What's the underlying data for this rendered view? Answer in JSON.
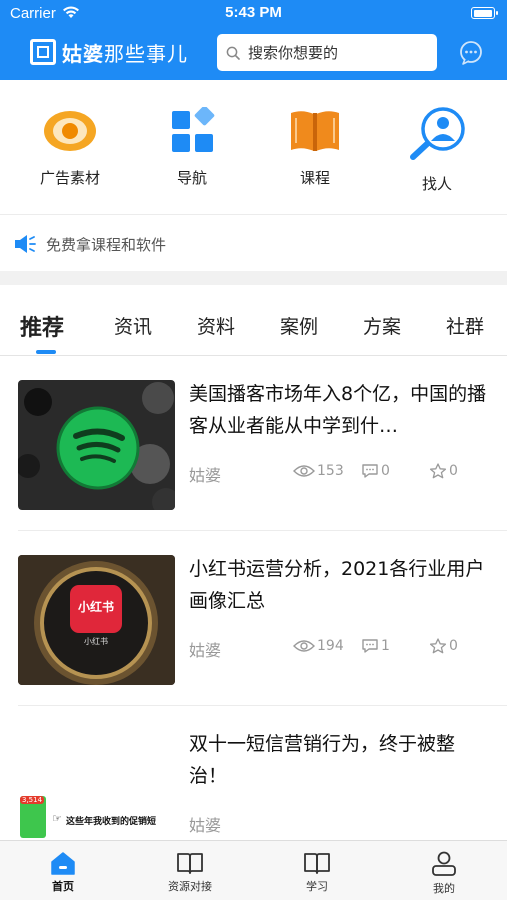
{
  "status_bar": {
    "carrier": "Carrier",
    "time": "5:43 PM",
    "battery_level": 1.0
  },
  "header": {
    "logo_bold": "姑婆",
    "logo_thin": "那些事儿",
    "search_placeholder": "搜索你想要的",
    "brand_color": "#1e8bf5"
  },
  "categories": [
    {
      "label": "广告素材",
      "icon": "eye-icon"
    },
    {
      "label": "导航",
      "icon": "grid-icon"
    },
    {
      "label": "课程",
      "icon": "book-icon"
    },
    {
      "label": "找人",
      "icon": "find-person-icon"
    }
  ],
  "notice": {
    "text": "免费拿课程和软件",
    "icon": "speaker-icon"
  },
  "tabs": [
    {
      "label": "推荐",
      "active": true
    },
    {
      "label": "资讯"
    },
    {
      "label": "资料"
    },
    {
      "label": "案例"
    },
    {
      "label": "方案"
    },
    {
      "label": "社群"
    }
  ],
  "articles": [
    {
      "title": "美国播客市场年入8个亿，中国的播客从业者能从中学到什…",
      "author": "姑婆",
      "views": "153",
      "comments": "0",
      "likes": "0",
      "thumb": "spotify-logo"
    },
    {
      "title": "小红书运营分析，2021各行业用户画像汇总",
      "author": "姑婆",
      "views": "194",
      "comments": "1",
      "likes": "0",
      "thumb": "xiaohongshu-logo",
      "thumb_label": "小红书",
      "thumb_caption": "小红书"
    },
    {
      "title": "双十一短信营销行为，终于被整治！",
      "author": "姑婆",
      "views": "",
      "comments": "",
      "likes": "",
      "thumb": "sms-screenshot",
      "thumb_caption": "这些年我收到的促销短",
      "thumb_badge": "3,514"
    }
  ],
  "tabbar": [
    {
      "label": "首页",
      "icon": "home-icon",
      "active": true
    },
    {
      "label": "资源对接",
      "icon": "open-book-icon"
    },
    {
      "label": "学习",
      "icon": "study-book-icon"
    },
    {
      "label": "我的",
      "icon": "user-icon"
    }
  ]
}
